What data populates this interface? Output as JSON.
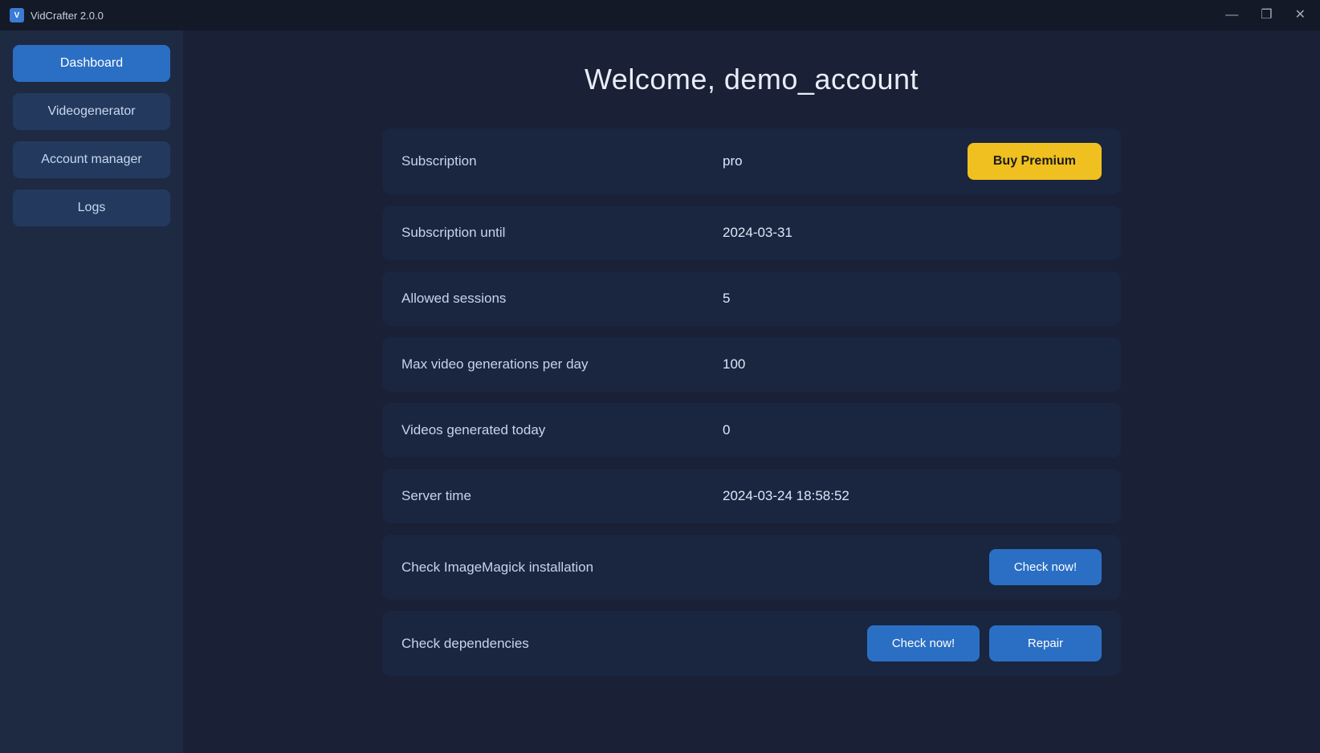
{
  "titlebar": {
    "icon_label": "V",
    "title": "VidCrafter 2.0.0",
    "minimize_label": "—",
    "maximize_label": "❐",
    "close_label": "✕"
  },
  "sidebar": {
    "items": [
      {
        "id": "dashboard",
        "label": "Dashboard",
        "active": true
      },
      {
        "id": "videogenerator",
        "label": "Videogenerator",
        "active": false
      },
      {
        "id": "account-manager",
        "label": "Account manager",
        "active": false
      },
      {
        "id": "logs",
        "label": "Logs",
        "active": false
      }
    ]
  },
  "main": {
    "welcome_text": "Welcome, demo_account",
    "rows": [
      {
        "id": "subscription",
        "label": "Subscription",
        "value": "pro",
        "action": "buy_premium"
      },
      {
        "id": "subscription-until",
        "label": "Subscription until",
        "value": "2024-03-31",
        "action": null
      },
      {
        "id": "allowed-sessions",
        "label": "Allowed sessions",
        "value": "5",
        "action": null
      },
      {
        "id": "max-video-gen",
        "label": "Max video generations per day",
        "value": "100",
        "action": null
      },
      {
        "id": "videos-today",
        "label": "Videos generated today",
        "value": "0",
        "action": null
      },
      {
        "id": "server-time",
        "label": "Server time",
        "value": "2024-03-24 18:58:52",
        "action": null
      },
      {
        "id": "imagemagick",
        "label": "Check ImageMagick installation",
        "value": "",
        "action": "check_imagemagick"
      },
      {
        "id": "dependencies",
        "label": "Check dependencies",
        "value": "",
        "action": "check_dependencies"
      }
    ],
    "buttons": {
      "buy_premium": "Buy Premium",
      "check_now": "Check now!",
      "repair": "Repair"
    }
  }
}
